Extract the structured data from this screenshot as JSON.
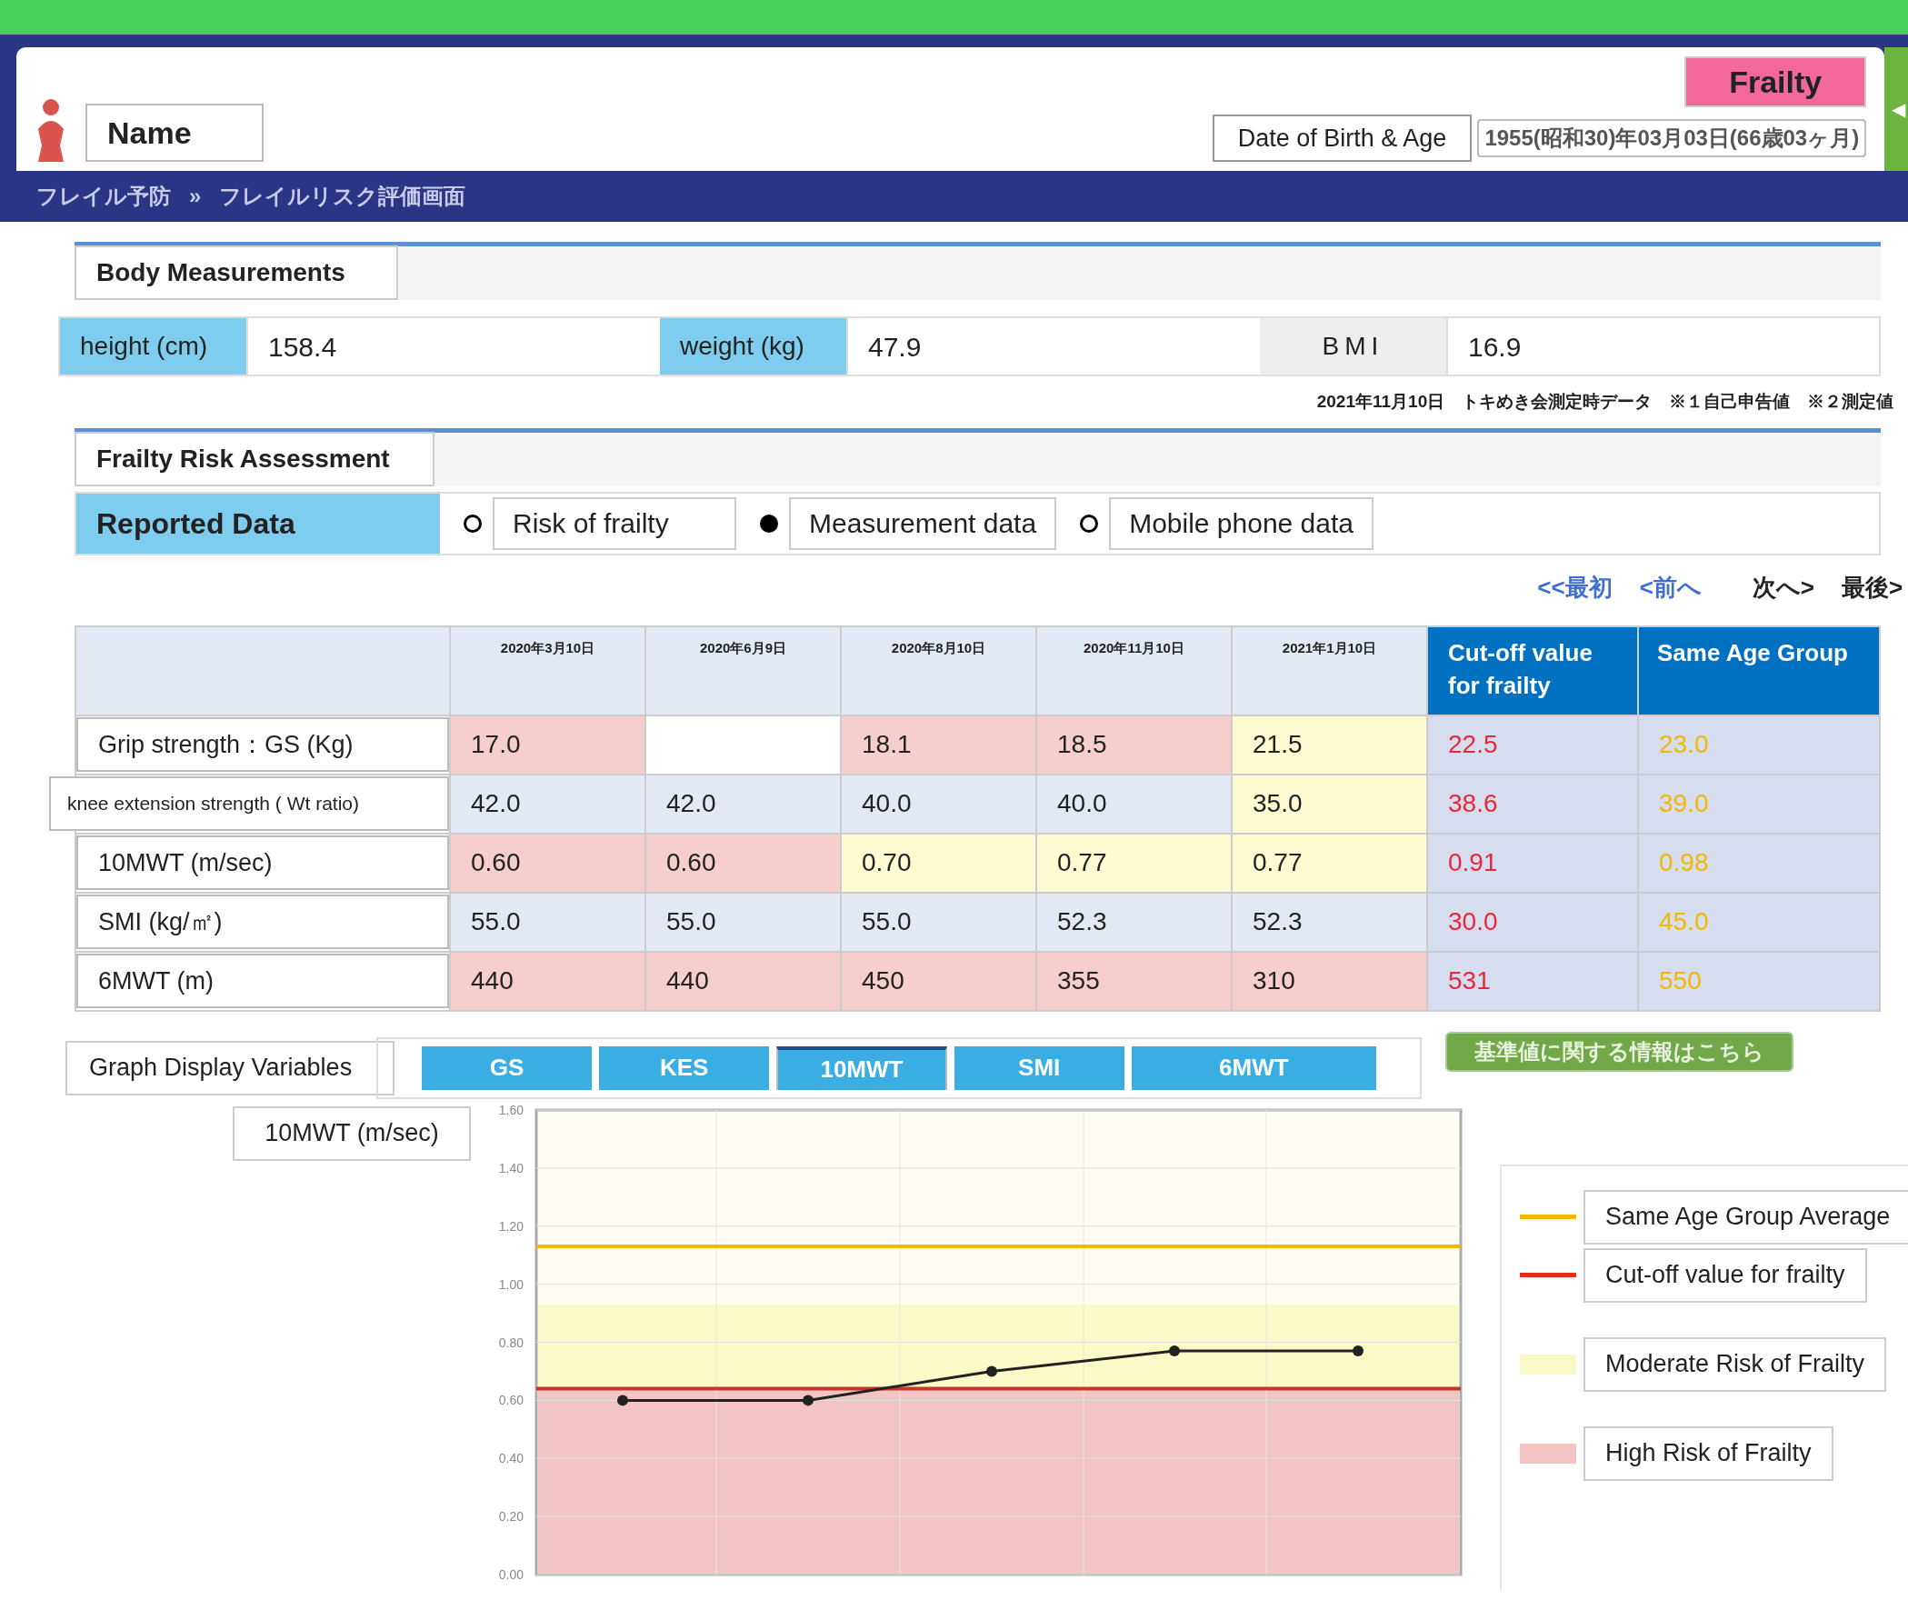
{
  "header": {
    "name_label": "Name",
    "dob_label": "Date of Birth & Age",
    "dob_value": "1955(昭和30)年03月03日(66歳03ヶ月)",
    "badge": "Frailty",
    "collapse_glyph": "◀"
  },
  "breadcrumb": [
    "フレイル予防",
    "フレイルリスク評価画面"
  ],
  "breadcrumb_separator": "»",
  "body_measurements": {
    "title": "Body Measurements",
    "fields": [
      {
        "label": "height (cm)",
        "value": "158.4",
        "kind": "blue"
      },
      {
        "label": "weight (kg)",
        "value": "47.9",
        "kind": "blue"
      },
      {
        "label": "BMI",
        "value": "16.9",
        "kind": "grey"
      }
    ],
    "note": "2021年11月10日　トキめき会測定時データ　※１自己申告値　※２測定値"
  },
  "assessment": {
    "title": "Frailty Risk Assessment",
    "data_label": "Reported Data",
    "options": [
      {
        "label": "Risk of frailty",
        "selected": false
      },
      {
        "label": "Measurement data",
        "selected": true
      },
      {
        "label": "Mobile phone data",
        "selected": false
      }
    ],
    "pager": [
      {
        "label": "<<最初",
        "kind": "link"
      },
      {
        "label": "<前へ",
        "kind": "link"
      },
      {
        "label": "次へ>",
        "kind": "plain"
      },
      {
        "label": "最後>",
        "kind": "plain"
      }
    ]
  },
  "table": {
    "columns": [
      "2020年3月10日",
      "2020年6月9日",
      "2020年8月10日",
      "2020年11月10日",
      "2021年1月10日"
    ],
    "cutoff_header": "Cut-off value for frailty",
    "same_age_header": "Same Age Group",
    "rows": [
      {
        "label": "Grip strength：GS (Kg)",
        "cells": [
          {
            "value": "17.0",
            "kind": "high"
          },
          {
            "kind": "blank"
          },
          {
            "value": "18.1",
            "kind": "high"
          },
          {
            "value": "18.5",
            "kind": "high"
          },
          {
            "value": "21.5",
            "kind": "moderate"
          }
        ],
        "cutoff": "22.5",
        "same_age": "23.0"
      },
      {
        "label": "knee extension strength ( Wt ratio)",
        "cells": [
          {
            "value": "42.0",
            "kind": "normal"
          },
          {
            "value": "42.0",
            "kind": "normal"
          },
          {
            "value": "40.0",
            "kind": "normal"
          },
          {
            "value": "40.0",
            "kind": "normal"
          },
          {
            "value": "35.0",
            "kind": "moderate"
          }
        ],
        "cutoff": "38.6",
        "same_age": "39.0"
      },
      {
        "label": "10MWT (m/sec)",
        "cells": [
          {
            "value": "0.60",
            "kind": "high"
          },
          {
            "value": "0.60",
            "kind": "high"
          },
          {
            "value": "0.70",
            "kind": "moderate"
          },
          {
            "value": "0.77",
            "kind": "moderate"
          },
          {
            "value": "0.77",
            "kind": "moderate"
          }
        ],
        "cutoff": "0.91",
        "same_age": "0.98"
      },
      {
        "label": "SMI (kg/㎡)",
        "cells": [
          {
            "value": "55.0",
            "kind": "normal"
          },
          {
            "value": "55.0",
            "kind": "normal"
          },
          {
            "value": "55.0",
            "kind": "normal"
          },
          {
            "value": "52.3",
            "kind": "normal"
          },
          {
            "value": "52.3",
            "kind": "normal"
          }
        ],
        "cutoff": "30.0",
        "same_age": "45.0"
      },
      {
        "label": "6MWT (m)",
        "cells": [
          {
            "value": "440",
            "kind": "high"
          },
          {
            "value": "440",
            "kind": "high"
          },
          {
            "value": "450",
            "kind": "high"
          },
          {
            "value": "355",
            "kind": "high"
          },
          {
            "value": "310",
            "kind": "high"
          }
        ],
        "cutoff": "531",
        "same_age": "550"
      }
    ]
  },
  "graph": {
    "title": "Graph Display Variables",
    "tabs": [
      {
        "label": "GS",
        "selected": false
      },
      {
        "label": "KES",
        "selected": false
      },
      {
        "label": "10MWT",
        "selected": true
      },
      {
        "label": "SMI",
        "selected": false
      },
      {
        "label": "6MWT",
        "selected": false
      }
    ],
    "info_button": "基準値に関する情報はこちら",
    "chart_data": {
      "type": "line",
      "grid": true,
      "ylim": [
        0,
        1.6
      ],
      "yticks": [
        {
          "value": 0,
          "label": "0.00"
        },
        {
          "value": 0.2,
          "label": "0.20"
        },
        {
          "value": 0.4,
          "label": "0.40"
        },
        {
          "value": 0.6,
          "label": "0.60"
        },
        {
          "value": 0.8,
          "label": "0.80"
        },
        {
          "value": 1.0,
          "label": "1.00"
        },
        {
          "value": 1.2,
          "label": "1.20"
        },
        {
          "value": 1.4,
          "label": "1.40"
        },
        {
          "value": 1.6,
          "label": "1.60"
        }
      ],
      "series": [
        {
          "name": "10MWT (m/sec)",
          "color": "#222222",
          "marker": "o",
          "values": [
            0.6,
            0.6,
            0.7,
            0.77,
            0.77
          ]
        }
      ],
      "ref_lines": [
        {
          "axis": "y",
          "value": 1.13,
          "color": "#f5b800"
        },
        {
          "axis": "y",
          "value": 0.64,
          "color": "#c0392b"
        }
      ]
    },
    "legend": [
      {
        "label": "Same Age Group Average",
        "kind": "line",
        "color": "#f5b800"
      },
      {
        "label": "Cut-off value for frailty",
        "kind": "line",
        "color": "#e52a1e"
      },
      {
        "label": "Moderate Risk of Frailty",
        "kind": "band",
        "color": "#fafac8"
      },
      {
        "label": "High Risk of Frailty",
        "kind": "band",
        "color": "#f2c4c4"
      }
    ]
  }
}
